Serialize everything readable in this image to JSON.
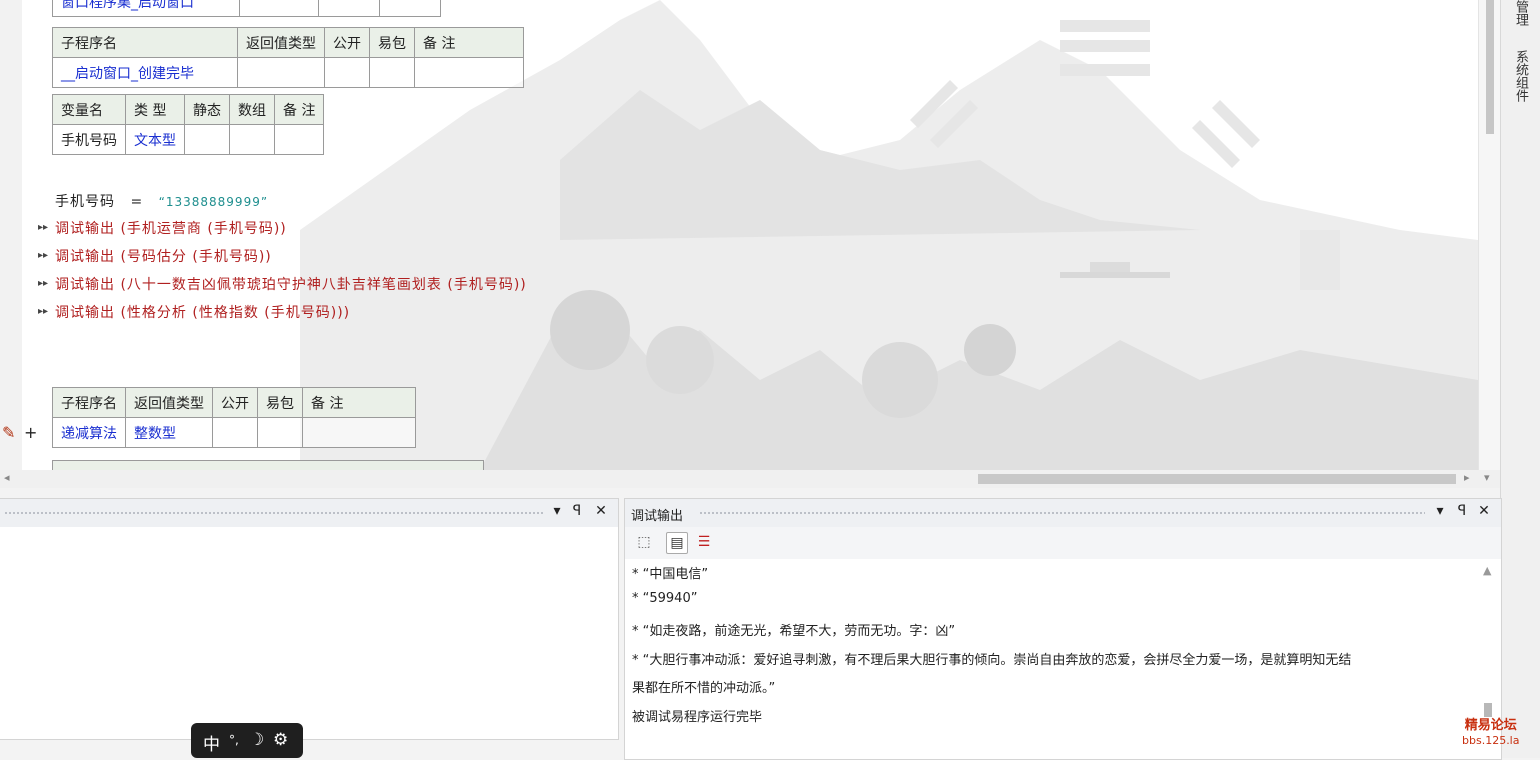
{
  "top_table": {
    "name": "窗口程序集_启动窗口"
  },
  "sub1": {
    "header": [
      "子程序名",
      "返回值类型",
      "公开",
      "易包",
      "备 注"
    ],
    "name": "__启动窗口_创建完毕"
  },
  "vars": {
    "header": [
      "变量名",
      "类 型",
      "静态",
      "数组",
      "备 注"
    ],
    "name": "手机号码",
    "type": "文本型"
  },
  "code": {
    "assign_var": "手机号码",
    "assign_op": "=",
    "assign_value": "“13388889999”",
    "lines": [
      {
        "fn": "调试输出",
        "args": "(手机运营商 (手机号码))"
      },
      {
        "fn": "调试输出",
        "args": "(号码估分 (手机号码))"
      },
      {
        "fn": "调试输出",
        "args": "(八十一数吉凶佩带琥珀守护神八卦吉祥笔画划表 (手机号码))"
      },
      {
        "fn": "调试输出",
        "args": "(性格分析 (性格指数 (手机号码)))"
      }
    ]
  },
  "sub2": {
    "header": [
      "子程序名",
      "返回值类型",
      "公开",
      "易包",
      "备 注"
    ],
    "name": "递减算法",
    "type": "整数型",
    "plus": "+"
  },
  "right_sidebar": {
    "tab1": "管理",
    "tab2": "系统组件"
  },
  "left_panel": {
    "dropdown": "▾",
    "pin": "ꟼ",
    "close": "✕"
  },
  "debug_panel": {
    "title": "调试输出",
    "dropdown": "▾",
    "pin": "ꟼ",
    "close": "✕",
    "lines": [
      "*  “中国电信”",
      "*  “59940”",
      "*  “如走夜路，前途无光，希望不大，劳而无功。字：凶”",
      "*  “大胆行事冲动派：爱好追寻刺激，有不理后果大胆行事的倾向。崇尚自由奔放的恋爱，会拼尽全力爱一场，是就算明知无结",
      "果都在所不惜的冲动派。”",
      "被调试易程序运行完毕"
    ]
  },
  "ime": {
    "mode": "中",
    "punct": "°,",
    "moon": "☽",
    "gear": "⚙"
  },
  "watermark": {
    "line1": "精易论坛",
    "line2": "bbs.125.la"
  },
  "colors": {
    "string": "#1e8e8e",
    "call": "#b02020",
    "link": "#1a2fd0"
  }
}
